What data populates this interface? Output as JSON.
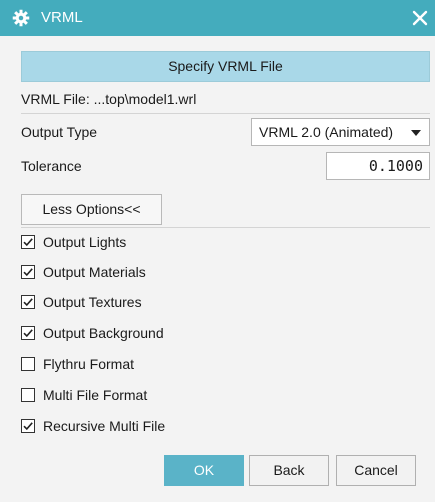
{
  "window": {
    "title": "VRML"
  },
  "colors": {
    "title_bar": "#44acbd",
    "primary_button": "#a9d8e8",
    "ok_button": "#5ab3c8"
  },
  "icons": {
    "title": "gear-icon",
    "close": "close-icon"
  },
  "main": {
    "specify_button": "Specify VRML File",
    "vrml_file": "VRML File: ...top\\model1.wrl",
    "output_type": {
      "label": "Output Type",
      "value": "VRML 2.0 (Animated)"
    },
    "tolerance": {
      "label": "Tolerance",
      "value": "0.1000"
    },
    "less_options": "Less Options<<",
    "options": [
      {
        "label": "Output Lights",
        "checked": true
      },
      {
        "label": "Output Materials",
        "checked": true
      },
      {
        "label": "Output Textures",
        "checked": true
      },
      {
        "label": "Output Background",
        "checked": true
      },
      {
        "label": "Flythru Format",
        "checked": false
      },
      {
        "label": "Multi File Format",
        "checked": false
      },
      {
        "label": "Recursive Multi File",
        "checked": true
      }
    ]
  },
  "footer": {
    "ok": "OK",
    "back": "Back",
    "cancel": "Cancel"
  }
}
